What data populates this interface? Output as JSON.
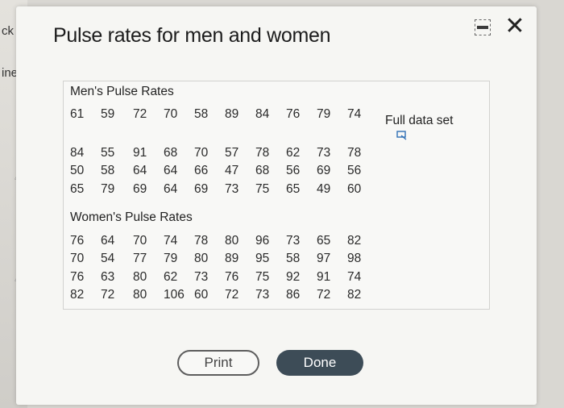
{
  "background": {
    "fragments": [
      "ck",
      "ine",
      "4",
      "4"
    ]
  },
  "dialog": {
    "title": "Pulse rates for men and women",
    "minimize_icon": "minimize-icon",
    "close_icon": "close-icon",
    "close_glyph": "✕"
  },
  "men": {
    "title": "Men's Pulse Rates",
    "rows": [
      [
        "61",
        "59",
        "72",
        "70",
        "58",
        "89",
        "84",
        "76",
        "79",
        "74"
      ],
      [
        "84",
        "55",
        "91",
        "68",
        "70",
        "57",
        "78",
        "62",
        "73",
        "78"
      ],
      [
        "50",
        "58",
        "64",
        "64",
        "66",
        "47",
        "68",
        "56",
        "69",
        "56"
      ],
      [
        "65",
        "79",
        "69",
        "64",
        "69",
        "73",
        "75",
        "65",
        "49",
        "60"
      ]
    ]
  },
  "women": {
    "title": "Women's Pulse Rates",
    "rows": [
      [
        "76",
        "64",
        "70",
        "74",
        "78",
        "80",
        "96",
        "73",
        "65",
        "82"
      ],
      [
        "70",
        "54",
        "77",
        "79",
        "80",
        "89",
        "95",
        "58",
        "97",
        "98"
      ],
      [
        "76",
        "63",
        "80",
        "62",
        "73",
        "76",
        "75",
        "92",
        "91",
        "74"
      ],
      [
        "82",
        "72",
        "80",
        "106",
        "60",
        "72",
        "73",
        "86",
        "72",
        "82"
      ]
    ]
  },
  "full_data": {
    "label": "Full data set",
    "icon": "expand-icon"
  },
  "buttons": {
    "print_label": "Print",
    "done_label": "Done"
  },
  "colors": {
    "done_button": "#3d4c57",
    "print_border": "#5d5d5d"
  }
}
